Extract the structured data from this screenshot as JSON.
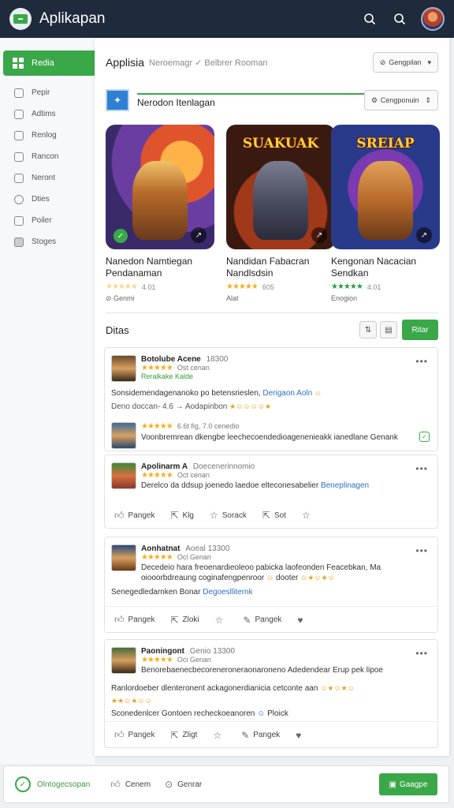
{
  "app": {
    "title": "Aplikapan"
  },
  "colors": {
    "topbar": "#1f2b3d",
    "accent": "#3aa848",
    "link": "#2a72c7",
    "star": "#f2b01e"
  },
  "sidebar": {
    "active": "Redia",
    "items": [
      {
        "label": "Pepir",
        "icon": "shield-icon"
      },
      {
        "label": "Adtims",
        "icon": "lock-icon"
      },
      {
        "label": "Renlog",
        "icon": "calendar-icon"
      },
      {
        "label": "Rancon",
        "icon": "image-icon"
      },
      {
        "label": "Neront",
        "icon": "grid-icon"
      },
      {
        "label": "Dties",
        "icon": "circle-icon"
      },
      {
        "label": "Poiler",
        "icon": "people-icon"
      },
      {
        "label": "Stoges",
        "icon": "storage-icon"
      }
    ]
  },
  "main": {
    "title": "Applisia",
    "subtitle": "Neroemagr ✓ Belbrer Rooman",
    "top_button": "Gengpilan",
    "section_title": "Nerodon Itenlagan",
    "section_button": "Cengponuin"
  },
  "games": [
    {
      "name": "Nanedon Namtiegan Pendanaman",
      "rating": "4.01",
      "downloads": "Genmi",
      "art_title": ""
    },
    {
      "name": "Nandidan Fabacran Nandlsdsin",
      "rating": "605",
      "downloads": "Alat",
      "art_title": "SUAKUAK"
    },
    {
      "name": "Kengonan Nacacian Sendkan",
      "rating": "4.01",
      "downloads": "Enogion",
      "art_title": "SREIAP"
    }
  ],
  "reviews": {
    "title": "Ditas",
    "add_button": "Ritar",
    "cards": [
      {
        "name": "Botolube Acene",
        "name_extra": "18300",
        "sub": "Ost cenan",
        "tag": "Reralkake Kalde",
        "line1": "Sonsidemendagenanoko po betensrieslen,",
        "line1_link": "Derigaon Aoln",
        "line2": "Deno doccan-  4.6  → Aodapinbon",
        "reply_meta": "6.6t fig, 7.0 cenedio",
        "reply_text": "Voonbremrean dkengbe leechecoendedioagenenieakk ianedlane Genank"
      },
      {
        "name": "Apolinarm A",
        "name_extra": "Doecenerinnomio",
        "sub": "Oct cenan",
        "line1": "Derelco  da  ddsup  joenedo  laedoe  elteconesabelier",
        "line1_link": "Beneplinagen",
        "actions": [
          "Pangek",
          "Klg",
          "Sorack",
          "Sot"
        ]
      },
      {
        "name": "Aonhatnat",
        "name_extra": "Aoeal 13300",
        "sub": "Ocl Genan",
        "line1": "Decedeio hara freoenardieoleoo pabicka laofeonden Feacebkan, Ma",
        "line2": "oiooorbdreaung coginafengpenroor",
        "line2_tail": "dooter",
        "line3": "Senegedledarnken  Bonar",
        "line3_link": "Degoeslliternk",
        "actions": [
          "Pangek",
          "Zloki",
          "",
          "Pangek"
        ]
      },
      {
        "name": "Paoningont",
        "name_extra": "Genio 13300",
        "sub": "Oci Genan",
        "line1": "Benorebaenecbecoreneroneraonaroneno Adedendear Erup pek lipoe",
        "line2": "Ranlordoeber dlenteronent  ackagonerdianicia  cetconte  aan",
        "line4": "Sconedenlcer Gontoen  recheckoeanoren",
        "line4_link": "Ploick",
        "actions": [
          "Pangek",
          "Zligt",
          "",
          "Pangek"
        ]
      }
    ]
  },
  "bottom": {
    "status": "Olntogecsopan",
    "item1": "Cenem",
    "item2": "Genrar",
    "button": "Gaagpe"
  }
}
